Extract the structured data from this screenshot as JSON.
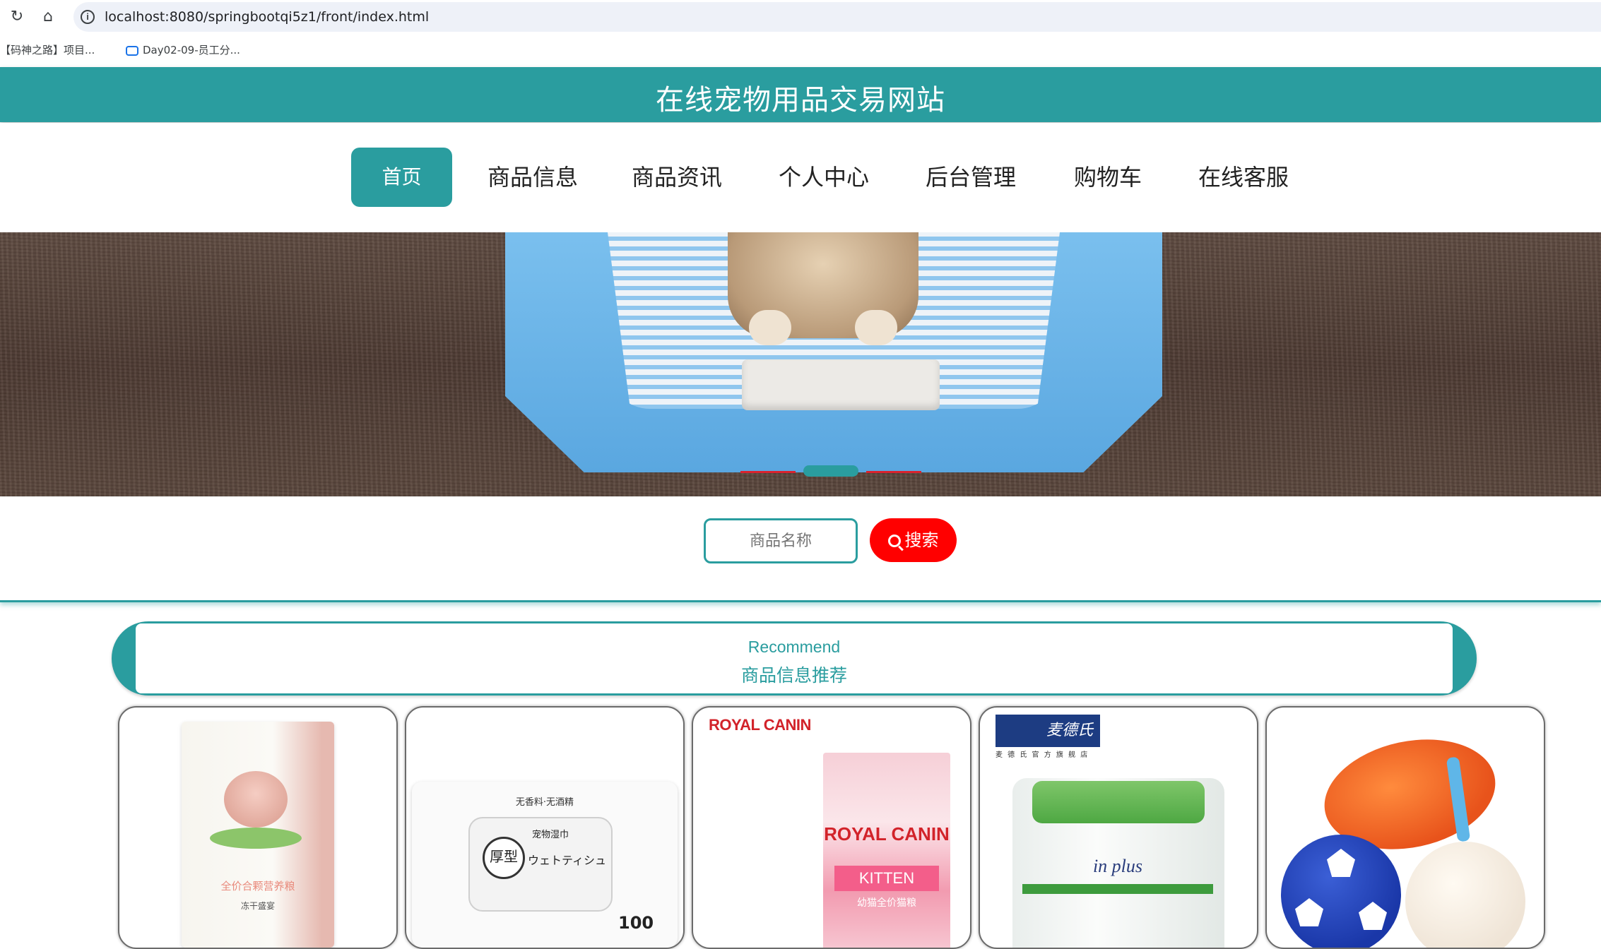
{
  "browser": {
    "url": "localhost:8080/springbootqi5z1/front/index.html",
    "bookmarks": [
      "【码神之路】项目...",
      "Day02-09-员工分..."
    ]
  },
  "site": {
    "title": "在线宠物用品交易网站",
    "accent_color": "#2a9d9f"
  },
  "nav": {
    "items": [
      "首页",
      "商品信息",
      "商品资讯",
      "个人中心",
      "后台管理",
      "购物车",
      "在线客服"
    ],
    "active_index": 0
  },
  "carousel": {
    "slides": 3,
    "active_index": 1
  },
  "search": {
    "placeholder": "商品名称",
    "button_label": "搜索",
    "button_color": "#ff0000"
  },
  "recommend": {
    "title_en": "Recommend",
    "title_zh": "商品信息推荐"
  },
  "products": [
    {
      "texts": [
        "全价合颗营养粮",
        "冻干盛宴"
      ]
    },
    {
      "texts": [
        "无香料·无酒精",
        "宠物湿巾",
        "厚型",
        "ウェトティシュ",
        "100"
      ]
    },
    {
      "texts": [
        "ROYAL CANIN",
        "ROYAL CANIN",
        "KITTEN",
        "幼猫全价猫粮"
      ]
    },
    {
      "texts": [
        "麦德氏",
        "麦 德 氏 官 方 旗 舰 店",
        "in plus"
      ]
    },
    {
      "texts": []
    }
  ]
}
